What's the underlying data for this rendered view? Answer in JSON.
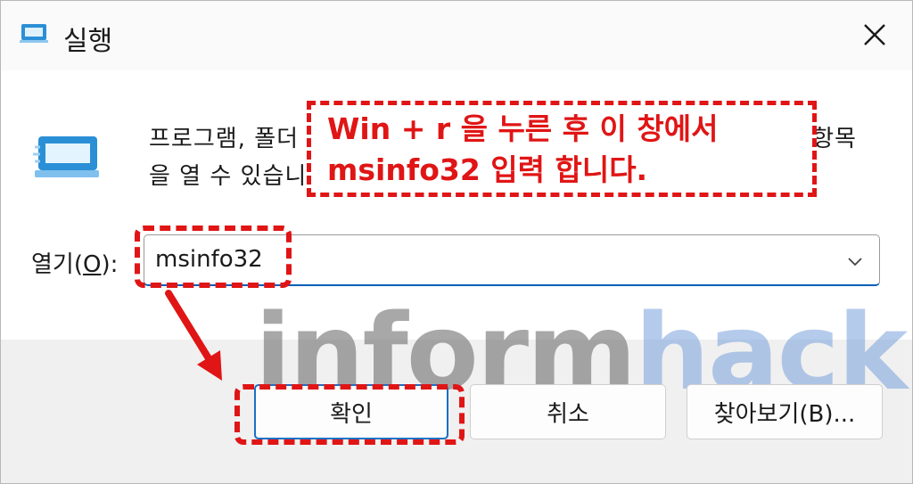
{
  "window": {
    "title": "실행",
    "close_icon": "close-icon",
    "app_icon": "run-dialog-icon"
  },
  "body": {
    "desc_line1_left": "프로그램, 폴더",
    "desc_line1_right": "항목",
    "desc_line2_left": "을 열 수 있습니"
  },
  "open": {
    "label_prefix": "열기(",
    "label_key": "O",
    "label_suffix": "):",
    "value": "msinfo32",
    "dropdown_icon": "chevron-down-icon"
  },
  "buttons": {
    "ok": "확인",
    "cancel": "취소",
    "browse": "찾아보기(B)..."
  },
  "annotation": {
    "line1": "Win + r 을 누른 후 이 창에서",
    "line2": "msinfo32 입력 합니다.",
    "color": "#e01515"
  },
  "watermark": {
    "part1": "inform",
    "part2": "hack"
  }
}
